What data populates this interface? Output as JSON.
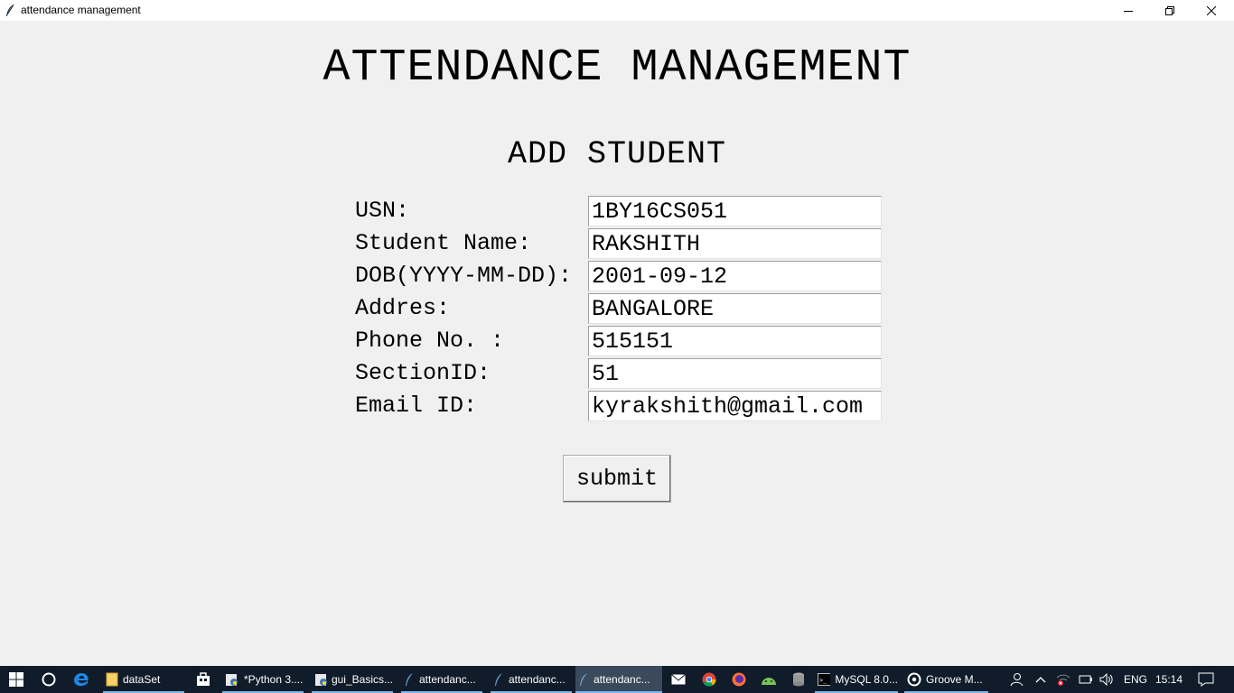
{
  "window": {
    "title": "attendance management"
  },
  "app": {
    "heading": "ATTENDANCE MANAGEMENT",
    "subheading": "ADD STUDENT",
    "fields": [
      {
        "label": "USN:",
        "value": "1BY16CS051"
      },
      {
        "label": "Student Name:",
        "value": "RAKSHITH"
      },
      {
        "label": "DOB(YYYY-MM-DD):",
        "value": "2001-09-12"
      },
      {
        "label": "Addres:",
        "value": "BANGALORE"
      },
      {
        "label": "Phone No. :",
        "value": "515151"
      },
      {
        "label": "SectionID:",
        "value": "51"
      },
      {
        "label": "Email ID:",
        "value": "kyrakshith@gmail.com"
      }
    ],
    "submit_label": "submit"
  },
  "taskbar": {
    "apps": [
      {
        "label": "dataSet",
        "icon": "folder-icon"
      },
      {
        "label": "*Python 3....",
        "icon": "python-idle-icon"
      },
      {
        "label": "gui_Basics...",
        "icon": "python-idle-icon"
      },
      {
        "label": "attendanc...",
        "icon": "feather-icon"
      },
      {
        "label": "attendanc...",
        "icon": "feather-icon"
      },
      {
        "label": "attendanc...",
        "icon": "feather-icon"
      },
      {
        "label": "MySQL 8.0...",
        "icon": "terminal-icon"
      },
      {
        "label": "Groove M...",
        "icon": "groove-music-icon"
      }
    ],
    "language": "ENG",
    "time": "15:14",
    "colors": {
      "background": "#101c2a",
      "active_underline": "#76b9ed"
    }
  }
}
